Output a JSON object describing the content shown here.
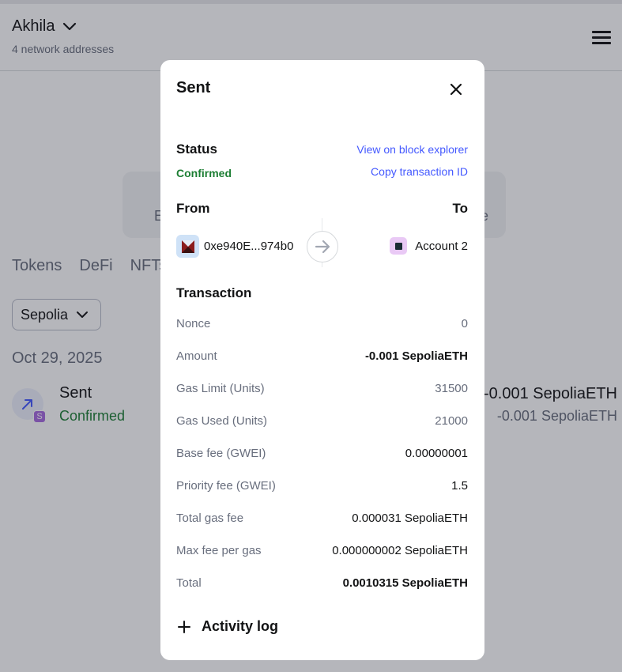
{
  "background": {
    "account_name": "Akhila",
    "network_addresses": "4 network addresses",
    "card_left_text": "E",
    "card_right_text": "e",
    "tabs": [
      "Tokens",
      "DeFi",
      "NFTs"
    ],
    "network_select": "Sepolia",
    "date": "Oct 29, 2025",
    "activity": {
      "title": "Sent",
      "status": "Confirmed",
      "badge": "S",
      "amount": "-0.001 SepoliaETH",
      "amount_secondary": "-0.001 SepoliaETH"
    }
  },
  "modal": {
    "title": "Sent",
    "status_heading": "Status",
    "status_value": "Confirmed",
    "view_explorer": "View on block explorer",
    "copy_tx": "Copy transaction ID",
    "from_heading": "From",
    "to_heading": "To",
    "from_address": "0xe940E...974b0",
    "to_account": "Account 2",
    "transaction_heading": "Transaction",
    "rows": [
      {
        "label": "Nonce",
        "value": "0"
      },
      {
        "label": "Amount",
        "value": "-0.001 SepoliaETH"
      },
      {
        "label": "Gas Limit (Units)",
        "value": "31500"
      },
      {
        "label": "Gas Used (Units)",
        "value": "21000"
      },
      {
        "label": "Base fee (GWEI)",
        "value": "0.00000001"
      },
      {
        "label": "Priority fee (GWEI)",
        "value": "1.5"
      },
      {
        "label": "Total gas fee",
        "value": "0.000031 SepoliaETH"
      },
      {
        "label": "Max fee per gas",
        "value": "0.000000002 SepoliaETH"
      },
      {
        "label": "Total",
        "value": "0.0010315 SepoliaETH"
      }
    ],
    "activity_log": "Activity log"
  },
  "colors": {
    "confirmed": "#1c7e33",
    "link": "#4459ff",
    "muted": "#686e7d",
    "overlay": "rgba(30,34,48,0.33)"
  }
}
